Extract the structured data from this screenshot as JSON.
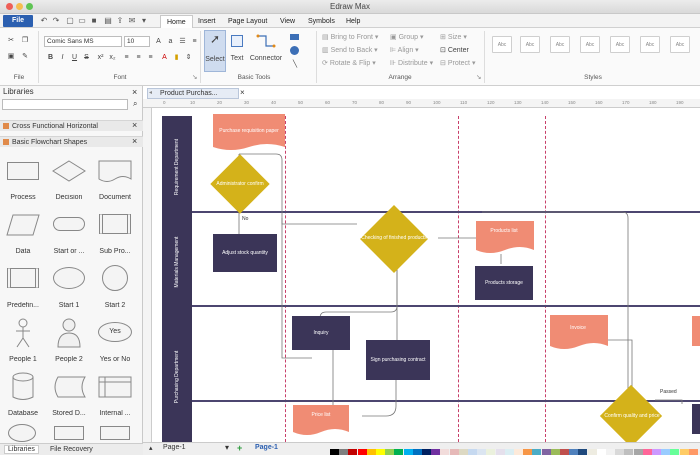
{
  "app": {
    "title": "Edraw Max"
  },
  "menu": {
    "file": "File",
    "items": [
      "Home",
      "Insert",
      "Page Layout",
      "View",
      "Symbols",
      "Help"
    ],
    "active": "Home"
  },
  "ribbon": {
    "file_group": "File",
    "font": {
      "family": "Comic Sans MS",
      "size": "10",
      "group_label": "Font"
    },
    "basic_tools": {
      "select": "Select",
      "text": "Text",
      "connector": "Connector",
      "group_label": "Basic Tools"
    },
    "arrange": {
      "bring_to_front": "Bring to Front",
      "send_to_back": "Send to Back",
      "rotate_flip": "Rotate & Flip",
      "group": "Group",
      "align": "Align",
      "distribute": "Distribute",
      "size": "Size",
      "center": "Center",
      "protect": "Protect",
      "group_label": "Arrange"
    },
    "styles": {
      "group_label": "Styles",
      "tiles": [
        "Abc",
        "Abc",
        "Abc",
        "Abc",
        "Abc",
        "Abc",
        "Abc"
      ]
    }
  },
  "libraries": {
    "title": "Libraries",
    "categories": [
      "Cross Functional Horizontal",
      "Basic Flowchart Shapes"
    ],
    "shapes": [
      [
        "Process",
        "Decision",
        "Document"
      ],
      [
        "Data",
        "Start or ...",
        "Sub Pro..."
      ],
      [
        "Predefin...",
        "Start 1",
        "Start 2"
      ],
      [
        "People 1",
        "People 2",
        "Yes or No"
      ],
      [
        "Database",
        "Stored D...",
        "Internal ..."
      ]
    ],
    "yes_label": "Yes",
    "tabs": [
      "Libraries",
      "File Recovery"
    ]
  },
  "document": {
    "tab": "Product Purchas...",
    "ruler_marks": [
      "0",
      "10",
      "20",
      "30",
      "40",
      "50",
      "60",
      "70",
      "80",
      "90",
      "100",
      "110",
      "120",
      "130",
      "140",
      "150",
      "160",
      "170",
      "180",
      "190"
    ],
    "lanes": [
      "Requirement Department",
      "Materials Management",
      "Purchasing Department"
    ],
    "shapes": {
      "purchase_requisition": "Purchase requisition paper",
      "administrator_confirm": "Administrator confirm",
      "no_label": "No",
      "adjust_stock": "Adjust stock quantity",
      "checking_finished": "Checking of finished products",
      "products_list": "Products list",
      "products_storage": "Products storage",
      "inquiry": "Inquiry",
      "sign_contract": "Sign purchasing contract",
      "price_list": "Price list",
      "invoice": "Invoice",
      "confirm_quality": "Confirm quality and price",
      "passed": "Passed"
    }
  },
  "pages": {
    "current": "Page-1",
    "tab": "Page-1"
  },
  "colors": {
    "accent": "#2b5fb0",
    "lane": "#3b3558",
    "salmon": "#f08c74",
    "gold": "#d4b21a",
    "palette": [
      "#000000",
      "#7f7f7f",
      "#c00000",
      "#ff0000",
      "#ffc000",
      "#ffff00",
      "#92d050",
      "#00b050",
      "#00b0f0",
      "#0070c0",
      "#002060",
      "#7030a0",
      "#f2dcdb",
      "#e6b9b8",
      "#ddd9c3",
      "#c6d9f0",
      "#dbe5f1",
      "#ebf1dd",
      "#e5e0ec",
      "#dbeef3",
      "#fdeada",
      "#f79646",
      "#4bacc6",
      "#8064a2",
      "#9bbb59",
      "#c0504d",
      "#4f81bd",
      "#1f497d",
      "#eeece1",
      "#ffffff",
      "#f2f2f2",
      "#d9d9d9",
      "#bfbfbf",
      "#a6a6a6",
      "#ff6699",
      "#cc99ff",
      "#99ccff",
      "#66ff99",
      "#ffcc66",
      "#ff9966"
    ]
  }
}
